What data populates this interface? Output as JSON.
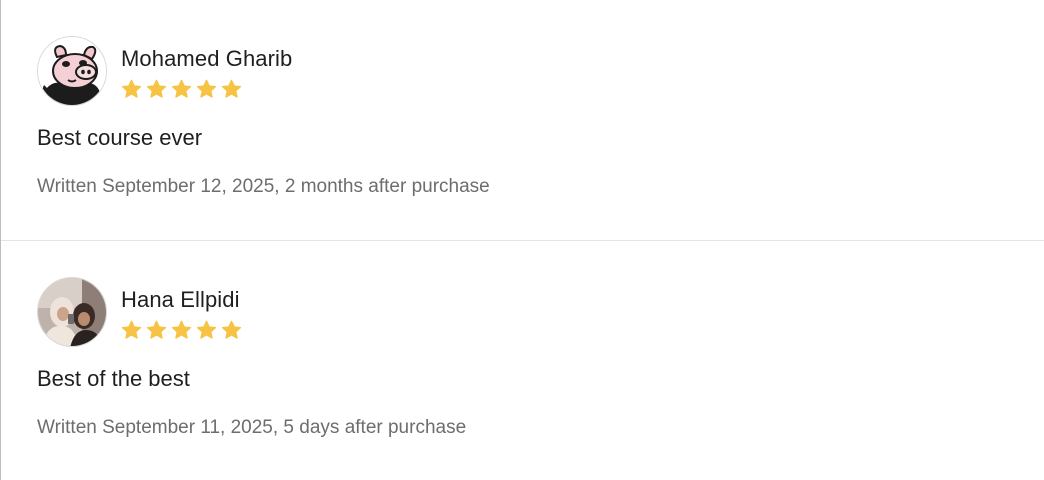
{
  "colors": {
    "star": "#F6C344",
    "divider": "#E4E4E4",
    "meta_text": "#6D6D6D",
    "primary_text": "#1F1F1F"
  },
  "reviews": [
    {
      "avatar_icon": "pig-face-avatar-icon",
      "reviewer_name": "Mohamed Gharib",
      "rating": 5,
      "max_rating": 5,
      "text": "Best course ever",
      "written": "Written September 12, 2025, 2 months after purchase"
    },
    {
      "avatar_icon": "photo-avatar",
      "reviewer_name": "Hana Ellpidi",
      "rating": 5,
      "max_rating": 5,
      "text": "Best of the best",
      "written": "Written September 11, 2025, 5 days after purchase"
    }
  ]
}
